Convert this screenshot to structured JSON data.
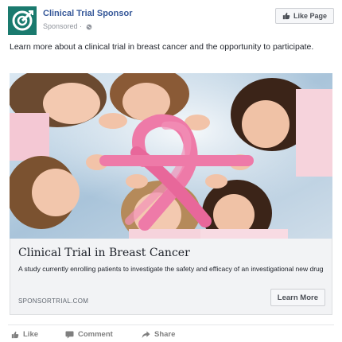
{
  "header": {
    "sponsor_name": "Clinical Trial Sponsor",
    "sponsored_label": "Sponsored · ",
    "like_page_label": "Like Page"
  },
  "post": {
    "text": "Learn more about a clinical trial in breast cancer and the opportunity to participate."
  },
  "hero": {
    "icon": "breast-cancer-ribbon-photo"
  },
  "card": {
    "title": "Clinical Trial in Breast Cancer",
    "description": "A study currently enrolling patients to investigate the safety and efficacy of an investigational new drug",
    "domain": "SPONSORTRIAL.COM",
    "cta_label": "Learn More"
  },
  "actions": {
    "like_label": "Like",
    "comment_label": "Comment",
    "share_label": "Share"
  },
  "colors": {
    "brand": "#1a7a6e",
    "link": "#365899",
    "ribbon": "#ee7aa8"
  }
}
